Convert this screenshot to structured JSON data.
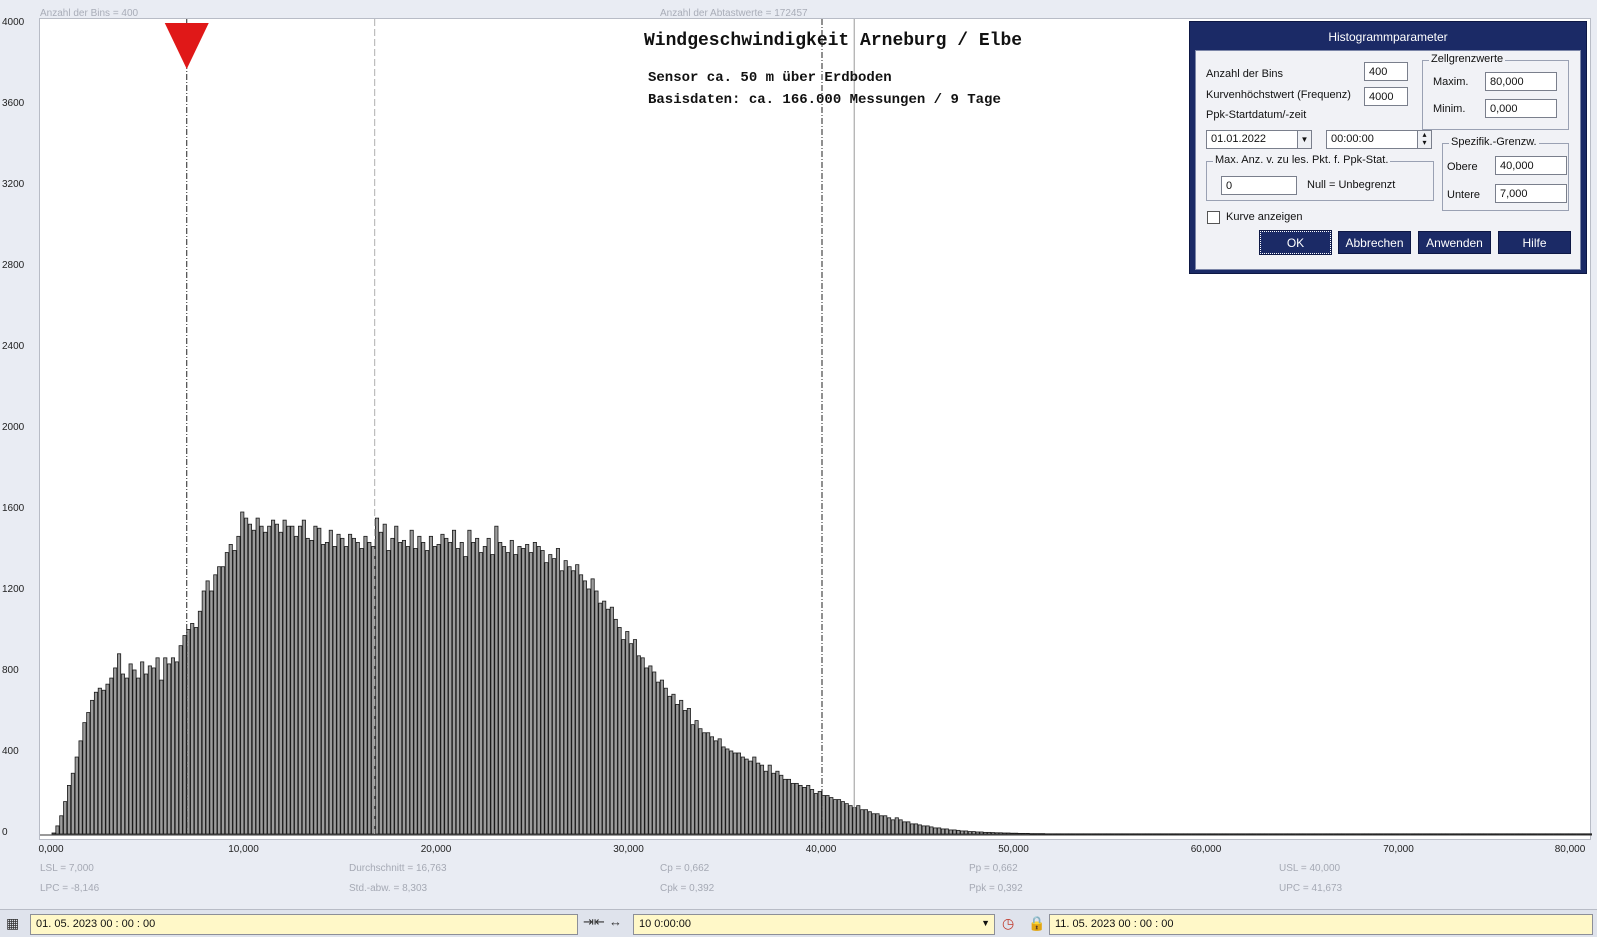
{
  "header": {
    "bins_info": "Anzahl der Bins =   400",
    "samples_info": "Anzahl der Abtastwerte = 172457"
  },
  "chart_title": "Windgeschwindigkeit  Arneburg / Elbe",
  "subtitle1": "Sensor ca. 50 m über Erdboden",
  "subtitle2": "Basisdaten:  ca. 166.000 Messungen / 9 Tage",
  "chart_data": {
    "type": "bar",
    "x_ticks": [
      "0,000",
      "10,000",
      "20,000",
      "30,000",
      "40,000",
      "50,000",
      "60,000",
      "70,000",
      "80,000"
    ],
    "y_ticks": [
      "0",
      "400",
      "800",
      "1200",
      "1600",
      "2000",
      "2400",
      "2800",
      "3200",
      "3600",
      "4000"
    ],
    "xlim": [
      0,
      80
    ],
    "ylim": [
      0,
      4000
    ],
    "bin_width": 0.2,
    "bin_start": 0,
    "values": [
      5,
      40,
      90,
      160,
      240,
      300,
      380,
      460,
      550,
      600,
      660,
      700,
      720,
      710,
      740,
      770,
      820,
      890,
      790,
      770,
      840,
      810,
      770,
      850,
      790,
      830,
      820,
      870,
      760,
      870,
      840,
      870,
      850,
      930,
      980,
      1010,
      1040,
      1020,
      1100,
      1200,
      1250,
      1200,
      1280,
      1320,
      1320,
      1390,
      1430,
      1400,
      1470,
      1590,
      1560,
      1530,
      1500,
      1560,
      1520,
      1490,
      1520,
      1550,
      1530,
      1490,
      1550,
      1520,
      1520,
      1470,
      1520,
      1550,
      1460,
      1450,
      1520,
      1510,
      1430,
      1440,
      1500,
      1420,
      1480,
      1460,
      1420,
      1480,
      1460,
      1440,
      1410,
      1470,
      1440,
      1420,
      1560,
      1490,
      1530,
      1400,
      1460,
      1520,
      1440,
      1450,
      1420,
      1500,
      1410,
      1470,
      1440,
      1400,
      1470,
      1420,
      1430,
      1480,
      1460,
      1440,
      1500,
      1410,
      1440,
      1370,
      1500,
      1440,
      1460,
      1390,
      1420,
      1460,
      1380,
      1520,
      1440,
      1420,
      1390,
      1450,
      1380,
      1420,
      1410,
      1430,
      1390,
      1440,
      1420,
      1400,
      1340,
      1380,
      1360,
      1410,
      1300,
      1350,
      1320,
      1300,
      1330,
      1280,
      1250,
      1210,
      1260,
      1200,
      1140,
      1150,
      1110,
      1120,
      1060,
      1020,
      960,
      1000,
      940,
      960,
      880,
      870,
      820,
      830,
      800,
      750,
      760,
      720,
      680,
      690,
      640,
      660,
      610,
      620,
      540,
      560,
      520,
      500,
      500,
      480,
      460,
      470,
      430,
      420,
      410,
      400,
      400,
      380,
      370,
      360,
      380,
      350,
      340,
      310,
      340,
      300,
      310,
      290,
      270,
      270,
      250,
      250,
      240,
      230,
      240,
      220,
      200,
      210,
      190,
      190,
      180,
      170,
      170,
      160,
      150,
      140,
      130,
      140,
      120,
      120,
      110,
      100,
      100,
      90,
      90,
      80,
      70,
      80,
      70,
      60,
      60,
      50,
      50,
      45,
      40,
      40,
      35,
      30,
      30,
      25,
      25,
      20,
      20,
      18,
      15,
      15,
      12,
      12,
      10,
      10,
      8,
      8,
      7,
      6,
      6,
      5,
      5,
      4,
      4,
      3,
      3,
      3,
      2,
      2,
      2,
      2,
      1,
      1,
      1,
      1,
      1,
      1,
      1,
      1,
      1,
      1,
      1,
      1,
      1,
      1,
      1,
      1,
      1,
      1,
      1,
      1,
      1,
      1,
      1,
      1,
      1,
      1,
      1,
      1,
      1,
      1,
      1,
      1,
      1,
      1,
      1,
      1,
      1,
      1,
      1,
      1,
      1,
      1,
      1,
      1,
      1,
      1,
      1,
      1,
      1,
      1,
      1,
      1,
      1,
      1,
      1,
      1,
      1,
      1,
      1,
      1,
      1,
      1,
      1,
      1,
      1,
      1,
      1,
      1,
      1,
      1,
      1,
      1,
      1,
      1,
      1,
      1,
      1,
      1,
      1,
      1,
      1,
      1,
      1,
      1,
      1,
      1,
      1,
      1,
      1,
      1,
      1,
      1,
      1,
      1,
      1,
      1,
      1,
      1,
      1,
      1,
      1,
      1,
      1,
      1,
      1,
      1,
      1,
      1,
      1,
      1,
      1,
      1,
      1,
      1,
      1,
      1,
      1,
      1,
      1,
      1,
      1,
      1,
      1,
      1,
      1,
      1,
      1,
      1,
      1,
      1,
      1,
      1,
      1,
      1,
      1,
      1,
      1,
      1,
      1,
      1,
      1,
      1,
      1,
      1,
      1,
      1,
      1,
      1,
      1,
      1,
      1,
      1,
      1,
      1,
      1,
      1
    ],
    "reference_lines": {
      "lsl": 7,
      "mean": 16.763,
      "usl": 40,
      "upc": 41.673
    }
  },
  "stats": {
    "lsl": "LSL = 7,000",
    "lpc": "LPC = -8,146",
    "mean": "Durchschnitt  = 16,763",
    "std": "Std.-abw.  = 8,303",
    "cp": "Cp   = 0,662",
    "cpk": "Cpk = 0,392",
    "pp": "Pp   = 0,662",
    "ppk": "Ppk = 0,392",
    "usl": "USL = 40,000",
    "upc": "UPC = 41,673"
  },
  "dialog": {
    "title": "Histogrammparameter",
    "bins_label": "Anzahl der Bins",
    "bins_value": "400",
    "curve_label": "Kurvenhöchstwert (Frequenz)",
    "curve_value": "4000",
    "ppk_label": "Ppk-Startdatum/-zeit",
    "date_value": "01.01.2022",
    "time_value": "00:00:00",
    "cell_group": "Zellgrenzwerte",
    "max_label": "Maxim.",
    "max_value": "80,000",
    "min_label": "Minim.",
    "min_value": "0,000",
    "maxpts_group": "Max. Anz. v. zu les. Pkt. f. Ppk-Stat.",
    "maxpts_value": "0",
    "null_label": "Null = Unbegrenzt",
    "spec_group": "Spezifik.-Grenzw.",
    "upper_label": "Obere",
    "upper_value": "40,000",
    "lower_label": "Untere",
    "lower_value": "7,000",
    "curve_check_label": "Kurve anzeigen",
    "ok": "OK",
    "cancel": "Abbrechen",
    "apply": "Anwenden",
    "help": "Hilfe"
  },
  "bottom_bar": {
    "start_date": "01. 05. 2023   00 : 00 : 00",
    "interval": "10  0:00:00",
    "end_date": "11. 05. 2023   00 : 00 : 00"
  }
}
